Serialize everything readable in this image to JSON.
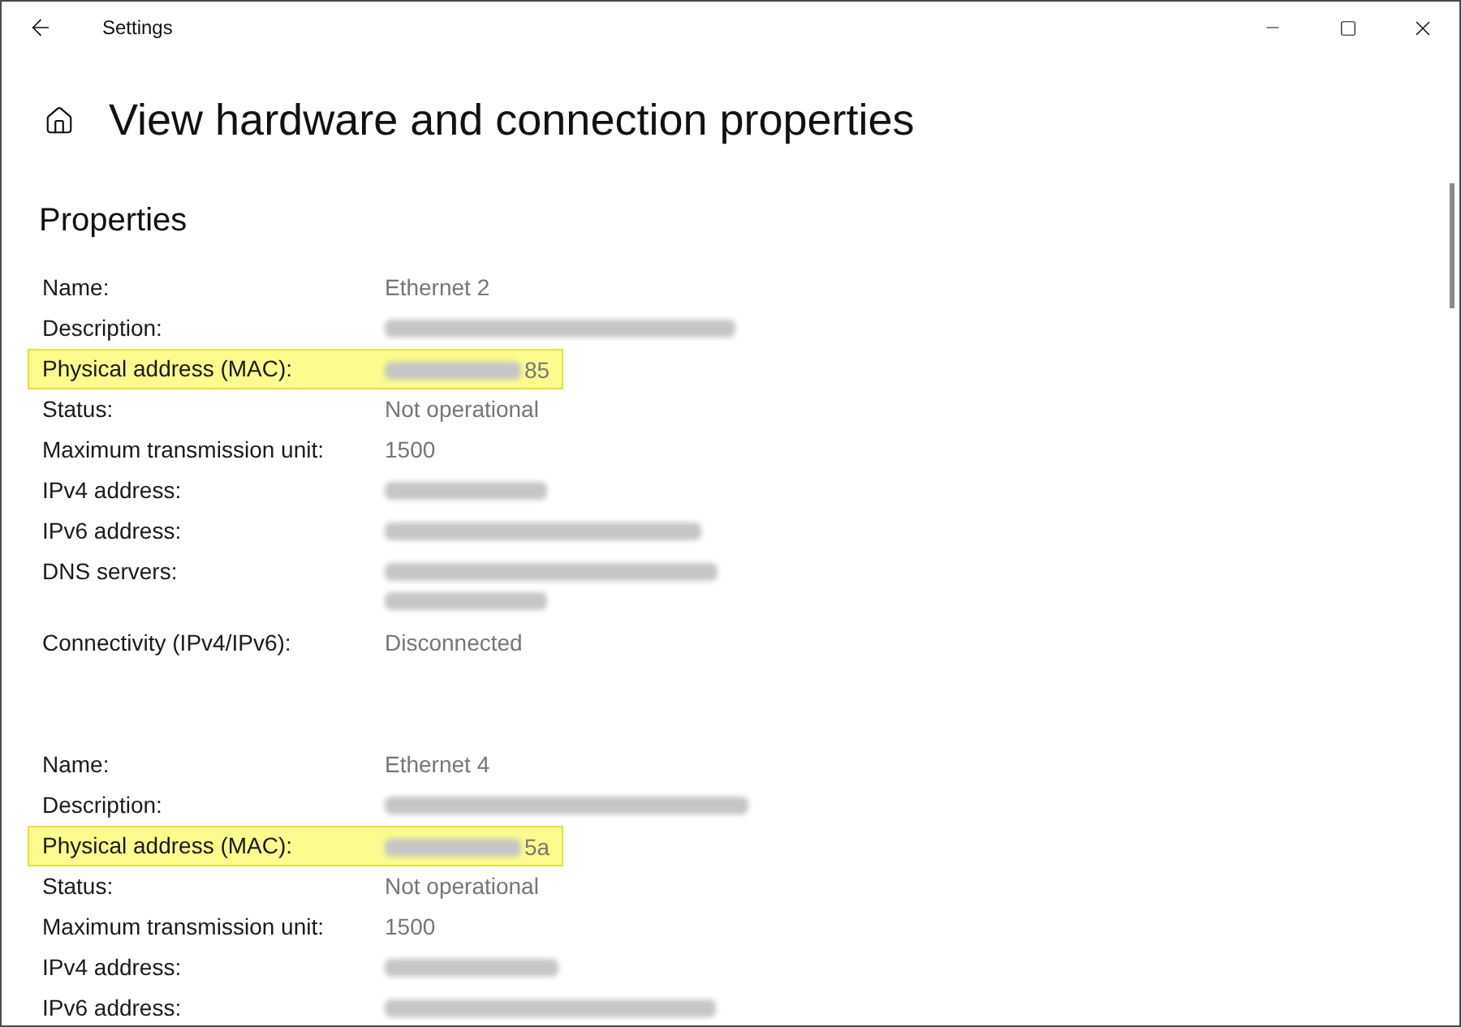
{
  "window": {
    "title": "Settings"
  },
  "page": {
    "title": "View hardware and connection properties"
  },
  "section": {
    "title": "Properties"
  },
  "adapters": [
    {
      "rows": [
        {
          "label": "Name:",
          "kind": "text",
          "value": "Ethernet 2",
          "highlighted": false
        },
        {
          "label": "Description:",
          "kind": "redacted",
          "highlighted": false
        },
        {
          "label": "Physical address (MAC):",
          "kind": "redacted_tail",
          "value": "85",
          "highlighted": true
        },
        {
          "label": "Status:",
          "kind": "text",
          "value": "Not operational",
          "highlighted": false
        },
        {
          "label": "Maximum transmission unit:",
          "kind": "text",
          "value": "1500",
          "highlighted": false
        },
        {
          "label": "IPv4 address:",
          "kind": "redacted",
          "highlighted": false
        },
        {
          "label": "IPv6 address:",
          "kind": "redacted",
          "highlighted": false
        },
        {
          "label": "DNS servers:",
          "kind": "redacted_multiline",
          "highlighted": false
        },
        {
          "label": "Connectivity (IPv4/IPv6):",
          "kind": "text",
          "value": "Disconnected",
          "highlighted": false
        }
      ]
    },
    {
      "rows": [
        {
          "label": "Name:",
          "kind": "text",
          "value": "Ethernet 4",
          "highlighted": false
        },
        {
          "label": "Description:",
          "kind": "redacted",
          "highlighted": false
        },
        {
          "label": "Physical address (MAC):",
          "kind": "redacted_tail",
          "value": "5a",
          "highlighted": true
        },
        {
          "label": "Status:",
          "kind": "text",
          "value": "Not operational",
          "highlighted": false
        },
        {
          "label": "Maximum transmission unit:",
          "kind": "text",
          "value": "1500",
          "highlighted": false
        },
        {
          "label": "IPv4 address:",
          "kind": "redacted",
          "highlighted": false
        },
        {
          "label": "IPv6 address:",
          "kind": "redacted",
          "highlighted": false
        }
      ]
    }
  ]
}
